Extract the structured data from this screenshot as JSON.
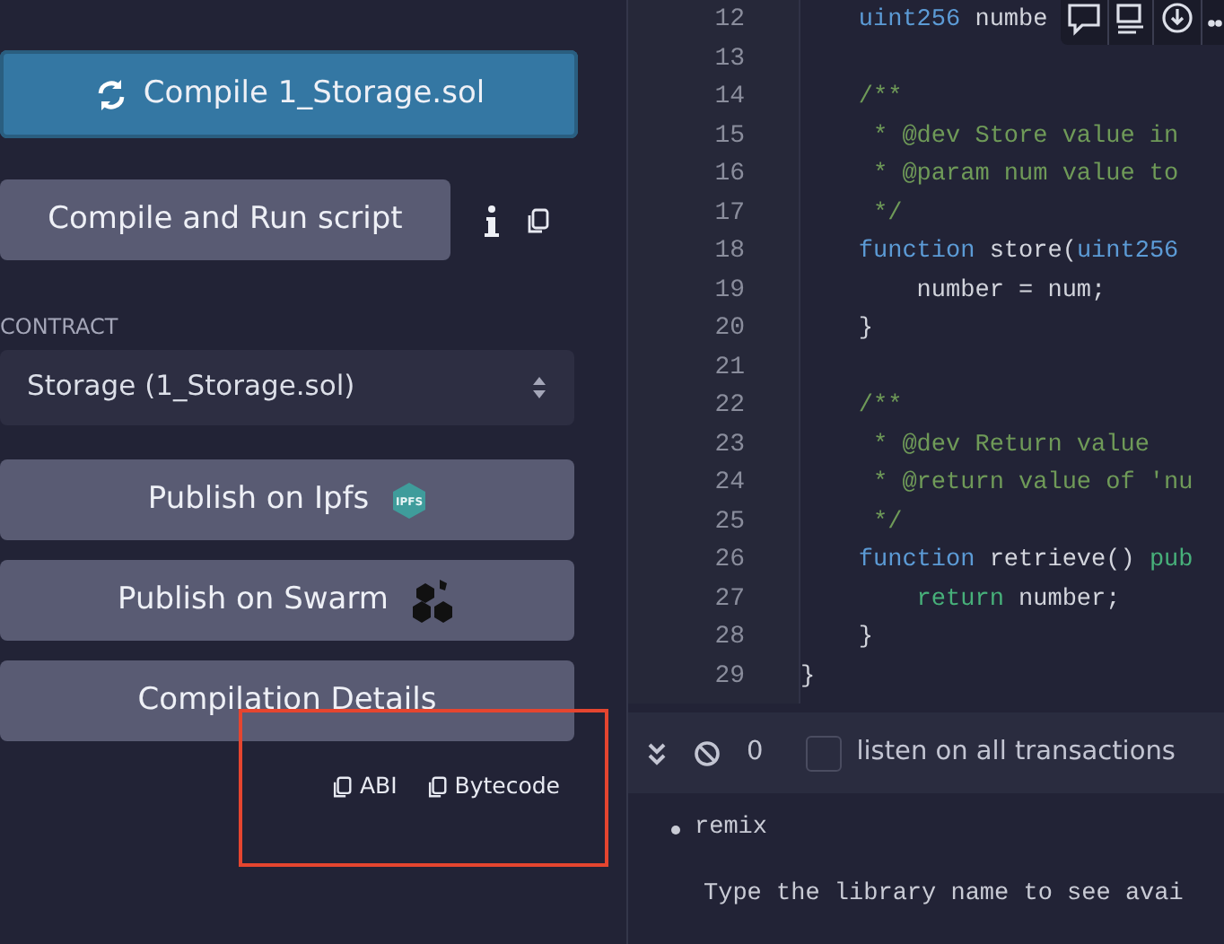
{
  "sidebar": {
    "compile_button": {
      "label": "Compile 1_Storage.sol"
    },
    "run_script_button": {
      "label": "Compile and Run script"
    },
    "contract_label": "CONTRACT",
    "contract_select": {
      "value": "Storage (1_Storage.sol)"
    },
    "publish_buttons": [
      {
        "label": "Publish on Ipfs",
        "kind": "ipfs",
        "badge": "IPFS"
      },
      {
        "label": "Publish on Swarm",
        "kind": "swarm"
      },
      {
        "label": "Compilation Details",
        "kind": "plain"
      }
    ],
    "copy_links": [
      {
        "label": "ABI"
      },
      {
        "label": "Bytecode"
      }
    ]
  },
  "editor": {
    "lines": [
      {
        "number": "12",
        "tokens": [
          {
            "kind": "type",
            "text": "    uint256"
          },
          {
            "kind": "plain",
            "text": " numbe"
          }
        ]
      },
      {
        "number": "13"
      },
      {
        "number": "14",
        "tokens": [
          {
            "kind": "comment",
            "text": "    /**"
          }
        ]
      },
      {
        "number": "15",
        "tokens": [
          {
            "kind": "comment",
            "text": "     * @dev Store value in"
          }
        ]
      },
      {
        "number": "16",
        "tokens": [
          {
            "kind": "comment",
            "text": "     * @param num value to"
          }
        ]
      },
      {
        "number": "17",
        "tokens": [
          {
            "kind": "comment",
            "text": "     */"
          }
        ]
      },
      {
        "number": "18",
        "tokens": [
          {
            "kind": "keyword",
            "text": "    function"
          },
          {
            "kind": "plain",
            "text": " store("
          },
          {
            "kind": "type",
            "text": "uint256"
          }
        ]
      },
      {
        "number": "19",
        "tokens": [
          {
            "kind": "plain",
            "text": "        number = num;"
          }
        ]
      },
      {
        "number": "20",
        "tokens": [
          {
            "kind": "plain",
            "text": "    }"
          }
        ]
      },
      {
        "number": "21"
      },
      {
        "number": "22",
        "tokens": [
          {
            "kind": "comment",
            "text": "    /**"
          }
        ]
      },
      {
        "number": "23",
        "tokens": [
          {
            "kind": "comment",
            "text": "     * @dev Return value"
          }
        ]
      },
      {
        "number": "24",
        "tokens": [
          {
            "kind": "comment",
            "text": "     * @return value of 'nu"
          }
        ]
      },
      {
        "number": "25",
        "tokens": [
          {
            "kind": "comment",
            "text": "     */"
          }
        ]
      },
      {
        "number": "26",
        "tokens": [
          {
            "kind": "keyword",
            "text": "    function"
          },
          {
            "kind": "plain",
            "text": " retrieve() "
          },
          {
            "kind": "modifier",
            "text": "pub"
          }
        ]
      },
      {
        "number": "27",
        "tokens": [
          {
            "kind": "modifier",
            "text": "        return"
          },
          {
            "kind": "plain",
            "text": " number;"
          }
        ]
      },
      {
        "number": "28",
        "tokens": [
          {
            "kind": "plain",
            "text": "    }"
          }
        ]
      },
      {
        "number": "29",
        "tokens": [
          {
            "kind": "plain",
            "text": "}"
          }
        ]
      }
    ]
  },
  "terminal": {
    "count": "0",
    "listen_checkbox": {
      "label": "listen on all transactions",
      "checked": false
    },
    "output": [
      {
        "kind": "bullet",
        "text": "remix"
      },
      {
        "kind": "text",
        "text": "Type the library name to see avai"
      }
    ]
  }
}
